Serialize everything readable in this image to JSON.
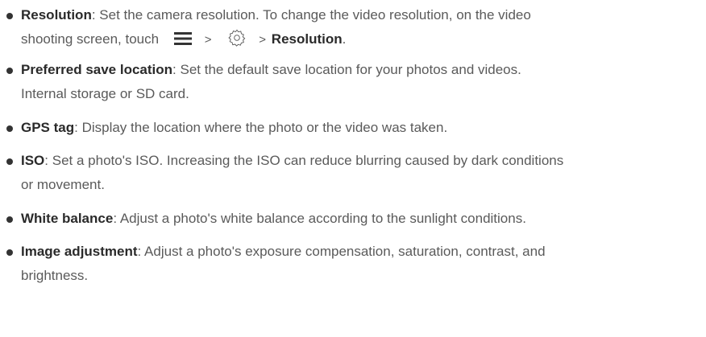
{
  "items": [
    {
      "term": "Resolution",
      "desc_line1": ": Set the camera resolution. To change the video resolution, on the video",
      "desc_line2_prefix": "shooting screen, touch",
      "sep1": ">",
      "sep2": ">",
      "term2": "Resolution",
      "term2_suffix": ".",
      "icon1": "menu-icon",
      "icon2": "settings-gear-icon"
    },
    {
      "term": "Preferred save location",
      "desc_line1": ": Set the default save location for your photos and videos.",
      "desc_line2": "Internal storage or SD card."
    },
    {
      "term": "GPS tag",
      "desc_line1": ": Display the location where the photo or the video was taken."
    },
    {
      "term": "ISO",
      "desc_line1": ": Set a photo's ISO. Increasing the ISO can reduce blurring caused by dark conditions",
      "desc_line2": "or movement."
    },
    {
      "term": "White balance",
      "desc_line1": ": Adjust a photo's white balance according to the sunlight conditions."
    },
    {
      "term": "Image adjustment",
      "desc_line1": ": Adjust a photo's exposure compensation, saturation, contrast, and",
      "desc_line2": "brightness."
    }
  ]
}
